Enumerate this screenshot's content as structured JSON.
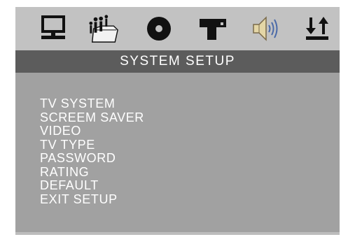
{
  "colors": {
    "icon_bar": "#c2c2c2",
    "title_bar": "#5c5c5c",
    "panel": "#a1a1a1",
    "text": "#ffffff",
    "icon": "#111111"
  },
  "icon_bar": {
    "icons": [
      "monitor-icon",
      "people-folder-icon",
      "disc-icon",
      "speaker-box-icon",
      "volume-icon",
      "up-down-arrows-icon"
    ]
  },
  "title": "SYSTEM SETUP",
  "menu": {
    "items": [
      {
        "label": "TV SYSTEM"
      },
      {
        "label": "SCREEM SAVER"
      },
      {
        "label": "VIDEO"
      },
      {
        "label": "TV TYPE"
      },
      {
        "label": "PASSWORD"
      },
      {
        "label": "RATING"
      },
      {
        "label": "DEFAULT"
      },
      {
        "label": "EXIT SETUP"
      }
    ]
  }
}
